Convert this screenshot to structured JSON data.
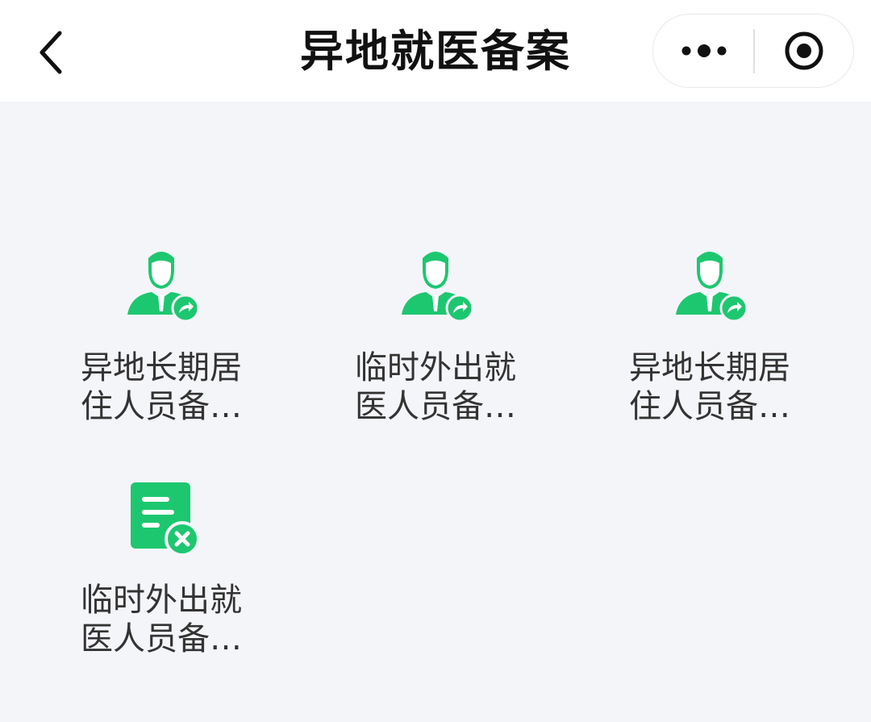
{
  "header": {
    "title": "异地就医备案",
    "back_icon": "chevron-left-icon",
    "more_icon": "more-dots-icon",
    "close_icon": "record-circle-icon"
  },
  "grid": {
    "accent_color": "#1dc76f",
    "items": [
      {
        "line1": "异地长期居",
        "line2": "住人员备…",
        "icon": "person-share-icon"
      },
      {
        "line1": "临时外出就",
        "line2": "医人员备…",
        "icon": "person-share-icon"
      },
      {
        "line1": "异地长期居",
        "line2": "住人员备…",
        "icon": "person-share-icon"
      },
      {
        "line1": "临时外出就",
        "line2": "医人员备…",
        "icon": "document-cancel-icon"
      }
    ]
  }
}
